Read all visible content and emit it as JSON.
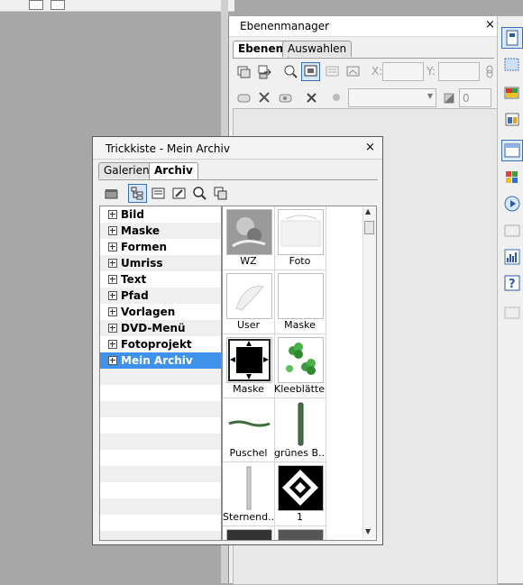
{
  "ebenenmanager": {
    "title": "Ebenenmanager",
    "close": "×",
    "tabs": [
      "Ebenen",
      "Auswahlen"
    ],
    "x_label": "X:",
    "y_label": "Y:",
    "opacity_value": "0"
  },
  "trickkiste": {
    "title": "Trickkiste - Mein Archiv",
    "close": "×",
    "tabs": [
      "Galerien",
      "Archiv"
    ],
    "tree": [
      "Bild",
      "Maske",
      "Formen",
      "Umriss",
      "Text",
      "Pfad",
      "Vorlagen",
      "DVD-Menü",
      "Fotoprojekt",
      "Mein Archiv"
    ],
    "selected_tree_item": "Mein Archiv",
    "items": [
      {
        "caption": "WZ"
      },
      {
        "caption": "Foto"
      },
      {
        "caption": "User"
      },
      {
        "caption": "Maske"
      },
      {
        "caption": "Maske"
      },
      {
        "caption": "Kleeblätter"
      },
      {
        "caption": "Puschel"
      },
      {
        "caption": "grünes B..."
      },
      {
        "caption": "Sternend..."
      },
      {
        "caption": "1"
      }
    ]
  },
  "colors": {
    "selection": "#3e92ea",
    "accent_border": "#3a6fb0"
  }
}
